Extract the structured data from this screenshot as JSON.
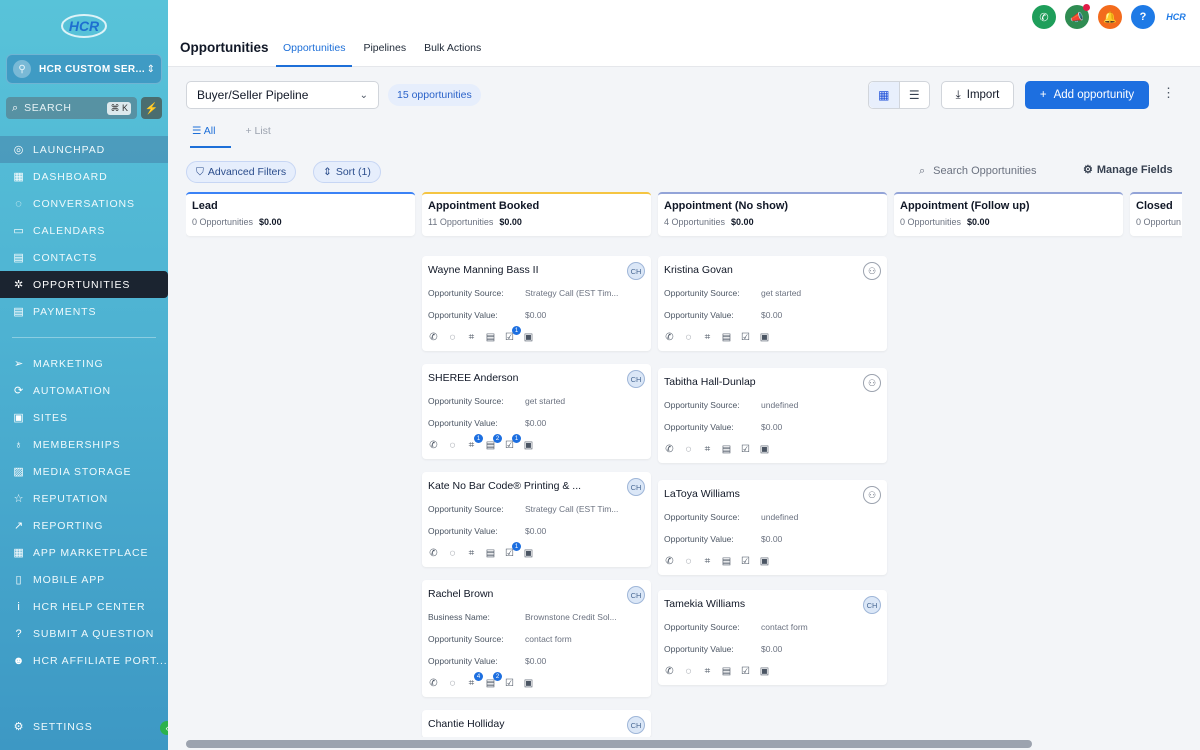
{
  "sidebar": {
    "logo_text": "HCR",
    "account_name": "HCR CUSTOM SER...",
    "search_label": "SEARCH",
    "search_kbd": "⌘ K",
    "items": [
      {
        "label": "LAUNCHPAD",
        "icon": "launchpad-icon"
      },
      {
        "label": "DASHBOARD",
        "icon": "dashboard-icon"
      },
      {
        "label": "CONVERSATIONS",
        "icon": "chat-icon"
      },
      {
        "label": "CALENDARS",
        "icon": "calendar-icon"
      },
      {
        "label": "CONTACTS",
        "icon": "contacts-icon"
      },
      {
        "label": "OPPORTUNITIES",
        "icon": "opportunities-icon"
      },
      {
        "label": "PAYMENTS",
        "icon": "payments-icon"
      },
      {
        "label": "MARKETING",
        "icon": "send-icon"
      },
      {
        "label": "AUTOMATION",
        "icon": "automation-icon"
      },
      {
        "label": "SITES",
        "icon": "sites-icon"
      },
      {
        "label": "MEMBERSHIPS",
        "icon": "badge-icon"
      },
      {
        "label": "MEDIA STORAGE",
        "icon": "image-icon"
      },
      {
        "label": "REPUTATION",
        "icon": "star-icon"
      },
      {
        "label": "REPORTING",
        "icon": "trend-icon"
      },
      {
        "label": "APP MARKETPLACE",
        "icon": "grid-icon"
      },
      {
        "label": "MOBILE APP",
        "icon": "phone-icon"
      },
      {
        "label": "HCR HELP CENTER",
        "icon": "info-icon"
      },
      {
        "label": "SUBMIT A QUESTION",
        "icon": "question-icon"
      },
      {
        "label": "HCR AFFILIATE PORT...",
        "icon": "users-icon"
      }
    ],
    "settings_label": "SETTINGS"
  },
  "header": {
    "title": "Opportunities",
    "tabs": [
      "Opportunities",
      "Pipelines",
      "Bulk Actions"
    ],
    "help_label": "?",
    "logo_text": "HCR"
  },
  "toolbar": {
    "pipeline": "Buyer/Seller Pipeline",
    "count": "15 opportunities",
    "import_label": "Import",
    "add_label": "Add opportunity",
    "view_tabs": [
      "All",
      "List"
    ],
    "advanced_filters": "Advanced Filters",
    "sort": "Sort (1)",
    "search_placeholder": "Search Opportunities",
    "manage_fields": "Manage Fields"
  },
  "columns": [
    {
      "title": "Lead",
      "count": "0 Opportunities",
      "value": "$0.00",
      "color": "#3b82f6"
    },
    {
      "title": "Appointment Booked",
      "count": "11 Opportunities",
      "value": "$0.00",
      "color": "#f5c542"
    },
    {
      "title": "Appointment (No show)",
      "count": "4 Opportunities",
      "value": "$0.00",
      "color": "#93a4d8"
    },
    {
      "title": "Appointment (Follow up)",
      "count": "0 Opportunities",
      "value": "$0.00",
      "color": "#93a4d8"
    },
    {
      "title": "Closed",
      "count": "0 Opportun",
      "value": "",
      "color": "#93a4d8"
    }
  ],
  "cards_col2": [
    {
      "name": "Wayne Manning Bass II",
      "avatar": "CH",
      "fields": [
        [
          "Opportunity Source:",
          "Strategy Call (EST Tim..."
        ],
        [
          "Opportunity Value:",
          "$0.00"
        ]
      ],
      "badges": [
        "",
        "",
        "",
        "",
        "1",
        ""
      ]
    },
    {
      "name": "SHEREE Anderson",
      "avatar": "CH",
      "fields": [
        [
          "Opportunity Source:",
          "get started"
        ],
        [
          "Opportunity Value:",
          "$0.00"
        ]
      ],
      "badges": [
        "",
        "",
        "1",
        "2",
        "1",
        ""
      ]
    },
    {
      "name": "Kate No Bar Code® Printing & ...",
      "avatar": "CH",
      "fields": [
        [
          "Opportunity Source:",
          "Strategy Call (EST Tim..."
        ],
        [
          "Opportunity Value:",
          "$0.00"
        ]
      ],
      "badges": [
        "",
        "",
        "",
        "",
        "1",
        ""
      ]
    },
    {
      "name": "Rachel Brown",
      "avatar": "CH",
      "fields": [
        [
          "Business Name:",
          "Brownstone Credit Sol..."
        ],
        [
          "Opportunity Source:",
          "contact form"
        ],
        [
          "Opportunity Value:",
          "$0.00"
        ]
      ],
      "badges": [
        "",
        "",
        "4",
        "2",
        "",
        ""
      ]
    },
    {
      "name": "Chantie Holliday",
      "avatar": "CH",
      "fields": [],
      "badges": []
    }
  ],
  "cards_col3": [
    {
      "name": "Kristina Govan",
      "avatar": "",
      "fields": [
        [
          "Opportunity Source:",
          "get started"
        ],
        [
          "Opportunity Value:",
          "$0.00"
        ]
      ],
      "badges": [
        "",
        "",
        "",
        "",
        "",
        ""
      ]
    },
    {
      "name": "Tabitha Hall-Dunlap",
      "avatar": "",
      "fields": [
        [
          "Opportunity Source:",
          "undefined"
        ],
        [
          "Opportunity Value:",
          "$0.00"
        ]
      ],
      "badges": [
        "",
        "",
        "",
        "",
        "",
        ""
      ]
    },
    {
      "name": "LaToya Williams",
      "avatar": "",
      "fields": [
        [
          "Opportunity Source:",
          "undefined"
        ],
        [
          "Opportunity Value:",
          "$0.00"
        ]
      ],
      "badges": [
        "",
        "",
        "",
        "",
        "",
        ""
      ]
    },
    {
      "name": "Tamekia Williams",
      "avatar": "CH",
      "fields": [
        [
          "Opportunity Source:",
          "contact form"
        ],
        [
          "Opportunity Value:",
          "$0.00"
        ]
      ],
      "badges": [
        "",
        "",
        "",
        "",
        "",
        ""
      ]
    }
  ]
}
